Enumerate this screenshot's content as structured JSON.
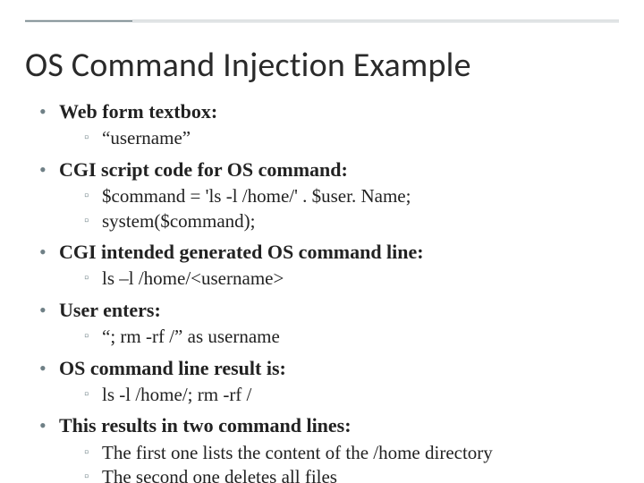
{
  "title": "OS Command Injection Example",
  "bullets": [
    {
      "label": "Web form textbox:",
      "bold": true,
      "subs": [
        "“username”"
      ]
    },
    {
      "label": "CGI script code for  OS command:",
      "bold": true,
      "subs": [
        "$command = 'ls -l /home/' . $user. Name;",
        "system($command);"
      ]
    },
    {
      "label": "CGI intended generated OS command line:",
      "bold": true,
      "subs": [
        "ls –l /home/<username>"
      ]
    },
    {
      "label": "User enters:",
      "bold": true,
      "subs": [
        "“; rm -rf /” as username"
      ]
    },
    {
      "label": "OS command line result is:",
      "bold": true,
      "subs": [
        "ls -l /home/; rm -rf /"
      ]
    },
    {
      "label": "This results in two command lines:",
      "bold": true,
      "subs": [
        "The first one lists the content of the /home directory",
        "The second one deletes  all files"
      ]
    }
  ]
}
